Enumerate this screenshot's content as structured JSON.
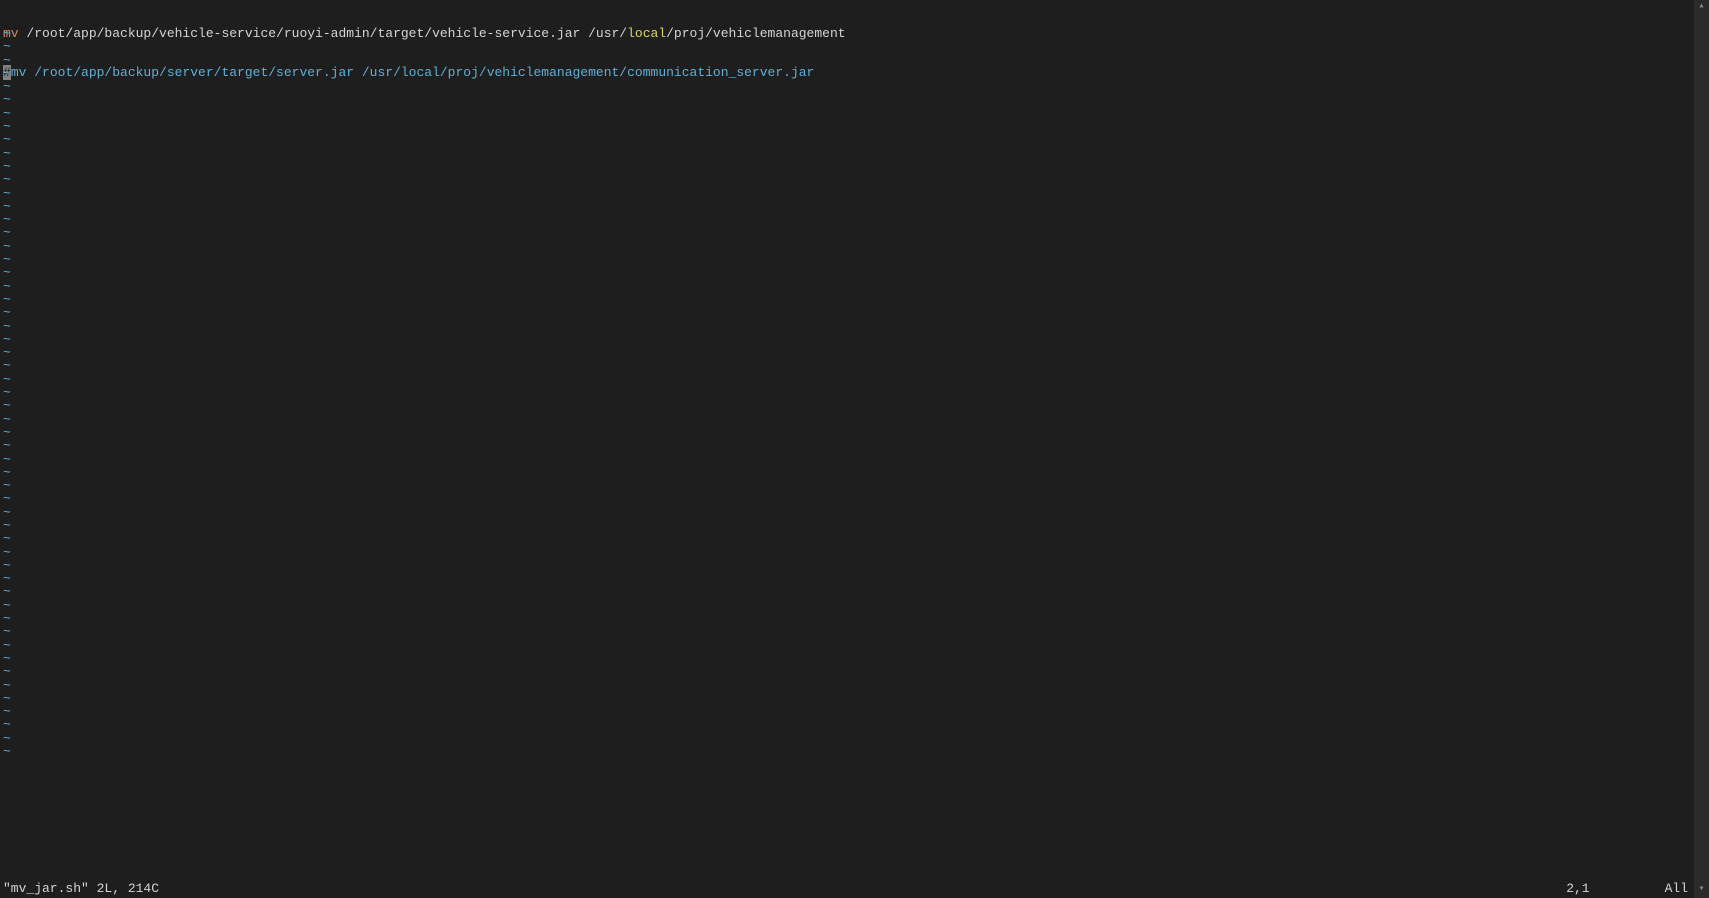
{
  "lines": {
    "line1": {
      "cmd": "mv",
      "path1_pre": " /root/app/backup/vehicle-service/ruoyi-admin/target/vehicle-service.jar /usr/",
      "highlight": "local",
      "path1_post": "/proj/vehiclemanagement"
    },
    "line2": {
      "cursor": "#",
      "text": "mv /root/app/backup/server/target/server.jar /usr/local/proj/vehiclemanagement/communication_server.jar"
    }
  },
  "tilde": "~",
  "tilde_count": 55,
  "statusbar": {
    "filename": "\"mv_jar.sh\" 2L, 214C",
    "position": "2,1",
    "scroll": "All"
  },
  "scrollbar": {
    "up": "▴",
    "down": "▾"
  }
}
